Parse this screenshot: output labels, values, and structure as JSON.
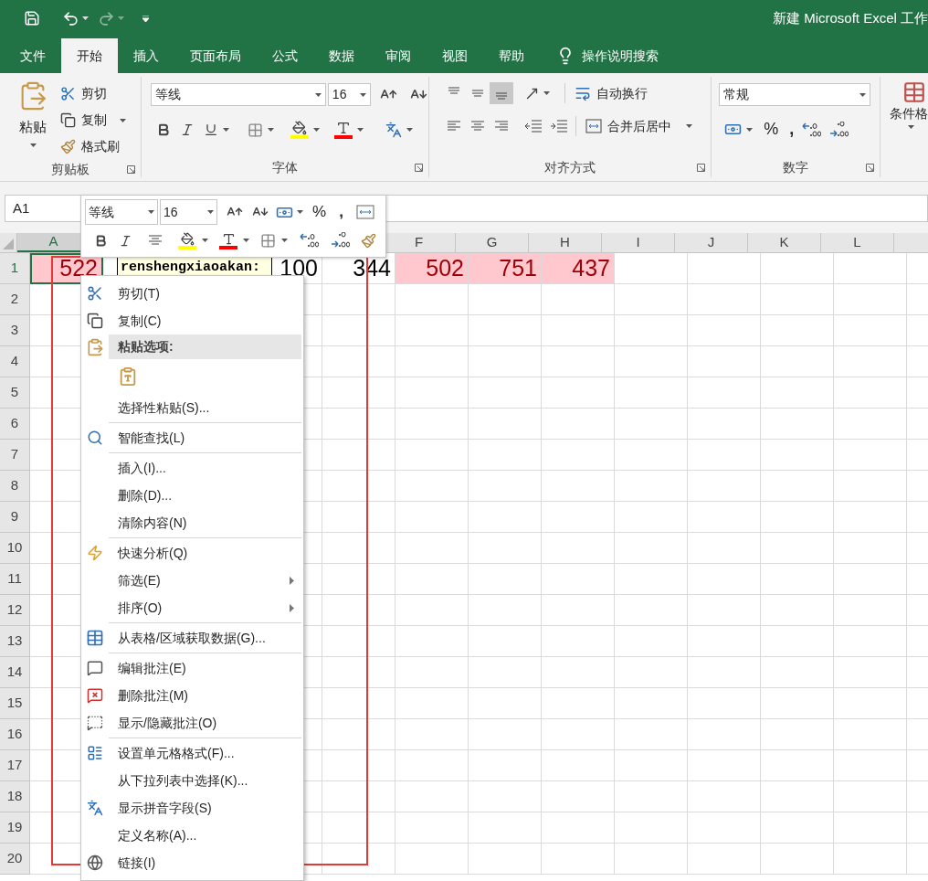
{
  "window": {
    "title": "新建 Microsoft Excel 工作"
  },
  "tabs": [
    {
      "label": "文件",
      "selected": false
    },
    {
      "label": "开始",
      "selected": true
    },
    {
      "label": "插入",
      "selected": false
    },
    {
      "label": "页面布局",
      "selected": false
    },
    {
      "label": "公式",
      "selected": false
    },
    {
      "label": "数据",
      "selected": false
    },
    {
      "label": "审阅",
      "selected": false
    },
    {
      "label": "视图",
      "selected": false
    },
    {
      "label": "帮助",
      "selected": false
    }
  ],
  "tell_me": {
    "label": "操作说明搜索"
  },
  "ribbon": {
    "clipboard": {
      "paste": "粘贴",
      "cut": "剪切",
      "copy": "复制",
      "format_painter": "格式刷",
      "label": "剪贴板"
    },
    "font": {
      "name": "等线",
      "size": "16",
      "label": "字体"
    },
    "alignment": {
      "vertical": [
        {
          "selected": false
        },
        {
          "selected": false
        },
        {
          "selected": true
        }
      ],
      "wrap_text": "自动换行",
      "merge_center": "合并后居中",
      "label": "对齐方式"
    },
    "number": {
      "format": "常规",
      "percent": "%",
      "comma": ",",
      "label": "数字"
    },
    "styles": {
      "conditional_format": "条件格"
    }
  },
  "name_box": {
    "value": "A1"
  },
  "mini_toolbar": {
    "font": "等线",
    "size": "16",
    "percent": "%",
    "comma": ","
  },
  "sheet": {
    "columns": [
      {
        "label": "A",
        "selected": true
      },
      {},
      {},
      {},
      {},
      {
        "label": "F",
        "selected": false
      },
      {
        "label": "G",
        "selected": false
      },
      {
        "label": "H",
        "selected": false
      },
      {
        "label": "I",
        "selected": false
      },
      {
        "label": "J",
        "selected": false
      },
      {
        "label": "K",
        "selected": false
      },
      {
        "label": "L",
        "selected": false
      }
    ],
    "rows": [
      {
        "label": "1",
        "selected": true,
        "cells": [
          {
            "value": "522",
            "highlighted": true,
            "selected": true
          },
          {},
          {},
          {
            "value": "100",
            "highlighted": false,
            "selected": false
          },
          {
            "value": "344",
            "highlighted": false,
            "selected": false
          },
          {
            "value": "502",
            "highlighted": true,
            "selected": false
          },
          {
            "value": "751",
            "highlighted": true,
            "selected": false
          },
          {
            "value": "437",
            "highlighted": true,
            "selected": false
          }
        ]
      },
      {
        "label": "2",
        "selected": false
      },
      {
        "label": "3",
        "selected": false
      },
      {
        "label": "4",
        "selected": false
      },
      {
        "label": "5",
        "selected": false
      },
      {
        "label": "6",
        "selected": false
      },
      {
        "label": "7",
        "selected": false
      },
      {
        "label": "8",
        "selected": false
      },
      {
        "label": "9",
        "selected": false
      },
      {
        "label": "10",
        "selected": false
      },
      {
        "label": "11",
        "selected": false
      },
      {
        "label": "12",
        "selected": false
      },
      {
        "label": "13",
        "selected": false
      },
      {
        "label": "14",
        "selected": false
      },
      {
        "label": "15",
        "selected": false
      },
      {
        "label": "16",
        "selected": false
      },
      {
        "label": "17",
        "selected": false
      },
      {
        "label": "18",
        "selected": false
      },
      {
        "label": "19",
        "selected": false
      },
      {
        "label": "20",
        "selected": false
      }
    ]
  },
  "comment": {
    "author": "renshengxiaoakan:"
  },
  "context_menu": {
    "items": [
      {
        "kind": "command",
        "label": "剪切(T)",
        "submenu": false
      },
      {
        "kind": "command",
        "label": "复制(C)",
        "submenu": false
      },
      {
        "kind": "header",
        "label": "粘贴选项:"
      },
      {
        "kind": "paste_option"
      },
      {
        "kind": "command",
        "label": "选择性粘贴(S)...",
        "submenu": false
      },
      {
        "kind": "separator"
      },
      {
        "kind": "command",
        "label": "智能查找(L)",
        "submenu": false
      },
      {
        "kind": "separator"
      },
      {
        "kind": "command",
        "label": "插入(I)...",
        "submenu": false
      },
      {
        "kind": "command",
        "label": "删除(D)...",
        "submenu": false
      },
      {
        "kind": "command",
        "label": "清除内容(N)",
        "submenu": false
      },
      {
        "kind": "separator"
      },
      {
        "kind": "command",
        "label": "快速分析(Q)",
        "submenu": false
      },
      {
        "kind": "command",
        "label": "筛选(E)",
        "submenu": true
      },
      {
        "kind": "command",
        "label": "排序(O)",
        "submenu": true
      },
      {
        "kind": "separator"
      },
      {
        "kind": "command",
        "label": "从表格/区域获取数据(G)...",
        "submenu": false
      },
      {
        "kind": "separator"
      },
      {
        "kind": "command",
        "label": "编辑批注(E)",
        "submenu": false
      },
      {
        "kind": "command",
        "label": "删除批注(M)",
        "submenu": false
      },
      {
        "kind": "command",
        "label": "显示/隐藏批注(O)",
        "submenu": false
      },
      {
        "kind": "separator"
      },
      {
        "kind": "command",
        "label": "设置单元格格式(F)...",
        "submenu": false
      },
      {
        "kind": "command",
        "label": "从下拉列表中选择(K)...",
        "submenu": false
      },
      {
        "kind": "command",
        "label": "显示拼音字段(S)",
        "submenu": false
      },
      {
        "kind": "command",
        "label": "定义名称(A)...",
        "submenu": false
      },
      {
        "kind": "command",
        "label": "链接(I)",
        "submenu": false
      }
    ]
  }
}
